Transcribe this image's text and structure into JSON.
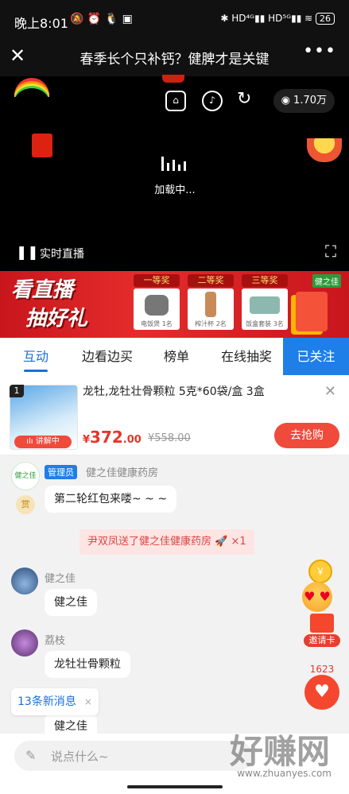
{
  "status_bar": {
    "time": "晚上8:01",
    "icons_left": "🔕 ⏰ 🐧 ▣",
    "icons_right": "✱ HD⁴ᴳ▮▮ HD⁵ᴳ▮▮ ≋",
    "battery": "26"
  },
  "nav": {
    "title": "春季长个只补钙？健脾才是关键",
    "close_icon": "✕",
    "more_icon": "•••"
  },
  "video": {
    "view_count": "1.70万",
    "loading_text": "加载中...",
    "live_label": "实时直播",
    "pause_icon": "❚❚",
    "fullscreen_icon": "⛶"
  },
  "banner": {
    "title_line1": "看直播",
    "title_line2": "抽好礼",
    "prizes": [
      {
        "level": "一等奖",
        "name": "电饭煲 1名"
      },
      {
        "level": "二等奖",
        "name": "榨汁杯 2名"
      },
      {
        "level": "三等奖",
        "name": "饭盒套装 3名"
      }
    ],
    "logo": "健之佳"
  },
  "tabs": {
    "items": [
      "互动",
      "边看边买",
      "榜单",
      "在线抽奖"
    ],
    "active_index": 0,
    "followed": "已关注"
  },
  "product": {
    "index": "1",
    "title": "龙牡,龙牡壮骨颗粒 5克*60袋/盒 3盒",
    "explaining": "讲解中",
    "price_symbol": "¥",
    "price": "372",
    "price_decimal": ".00",
    "original_price": "¥558.00",
    "buy_label": "去抢购",
    "close_icon": "✕"
  },
  "chat": {
    "admin_badge": "管理员",
    "admin_name": "健之佳健康药房",
    "reward_icon": "赏",
    "admin_message": "第二轮红包来喽~ ~ ~",
    "gift_notice": "尹双凤送了健之佳健康药房 🚀 ×1",
    "messages": [
      {
        "user": "健之佳",
        "text": "健之佳"
      },
      {
        "user": "荔枝",
        "text": "龙牡壮骨颗粒"
      },
      {
        "user": "",
        "text": "健之佳"
      }
    ],
    "new_messages": "13条新消息",
    "new_messages_close": "×"
  },
  "floats": {
    "coin": "￥",
    "invite_label": "邀请卡",
    "like_count": "1623",
    "like_icon": "♥"
  },
  "input": {
    "placeholder": "说点什么~",
    "pen_icon": "✎"
  },
  "watermark": {
    "text": "好赚网",
    "url": "www.zhuanyes.com"
  },
  "colors": {
    "accent_blue": "#1e7fe8",
    "price_red": "#e6362a",
    "banner_red": "#c8161d"
  }
}
